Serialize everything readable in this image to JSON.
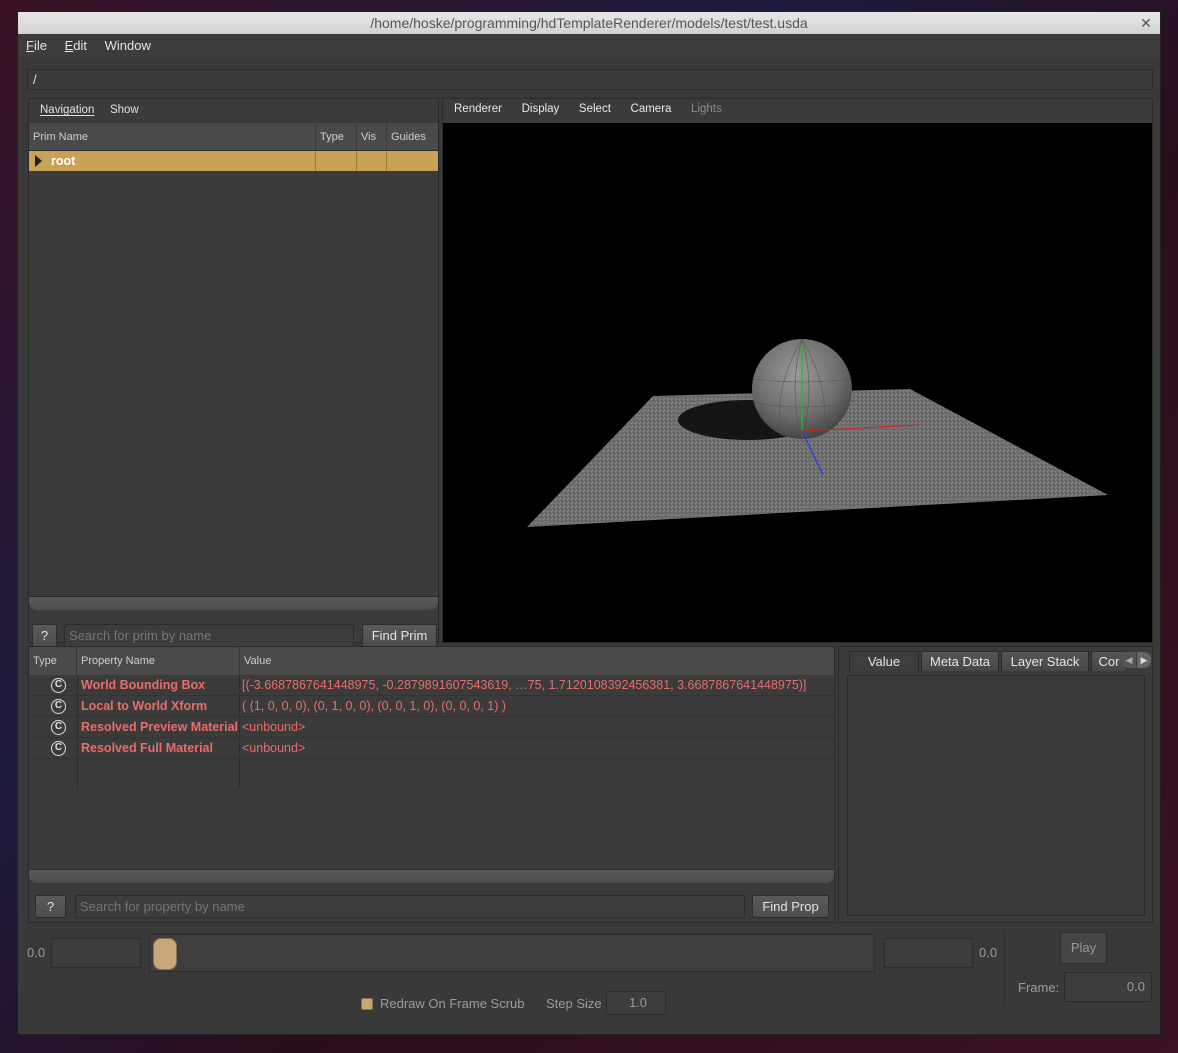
{
  "window": {
    "title": "/home/hoske/programming/hdTemplateRenderer/models/test/test.usda",
    "close_glyph": "✕"
  },
  "menu": [
    {
      "label": "File",
      "mnemonic": "F",
      "rest": "ile"
    },
    {
      "label": "Edit",
      "mnemonic": "E",
      "rest": "dit"
    },
    {
      "label": "Window",
      "mnemonic": "",
      "rest": "Window"
    }
  ],
  "path": "/",
  "prim_panel": {
    "menu": [
      "Navigation",
      "Show"
    ],
    "columns": [
      "Prim Name",
      "Type",
      "Vis",
      "Guides"
    ],
    "rows": [
      {
        "name": "root",
        "type": "",
        "vis": "",
        "guides": ""
      }
    ],
    "help_label": "?",
    "search_placeholder": "Search for prim by name",
    "find_label": "Find Prim"
  },
  "viewport": {
    "menu": [
      "Renderer",
      "Display",
      "Select",
      "Camera",
      "Lights"
    ],
    "disabled_menu": "Lights"
  },
  "property_panel": {
    "columns": [
      "Type",
      "Property Name",
      "Value"
    ],
    "rows": [
      {
        "icon": "C",
        "name": "World Bounding Box",
        "value": "[(-3.6687867641448975, -0.2879891607543619, …75, 1.7120108392456381, 3.6687867641448975)]"
      },
      {
        "icon": "C",
        "name": "Local to World Xform",
        "value": "( (1, 0, 0, 0), (0, 1, 0, 0), (0, 0, 1, 0), (0, 0, 0, 1) )"
      },
      {
        "icon": "C",
        "name": "Resolved Preview Material",
        "value": "<unbound>"
      },
      {
        "icon": "C",
        "name": "Resolved Full Material",
        "value": "<unbound>"
      }
    ],
    "help_label": "?",
    "search_placeholder": "Search for property by name",
    "find_label": "Find Prop"
  },
  "inspector": {
    "tabs": [
      "Value",
      "Meta Data",
      "Layer Stack",
      "Cor"
    ],
    "active_tab": "Value"
  },
  "timeline": {
    "start_value": "0.0",
    "end_value": "0.0",
    "play_label": "Play",
    "frame_label": "Frame:",
    "frame_value": "0.0",
    "redraw_label": "Redraw On Frame Scrub",
    "redraw_checked": true,
    "step_label": "Step Size",
    "step_value": "1.0"
  },
  "colors": {
    "selection": "#c8a357",
    "property_text": "#e86d6d",
    "scrub_handle": "#c9a77a"
  }
}
